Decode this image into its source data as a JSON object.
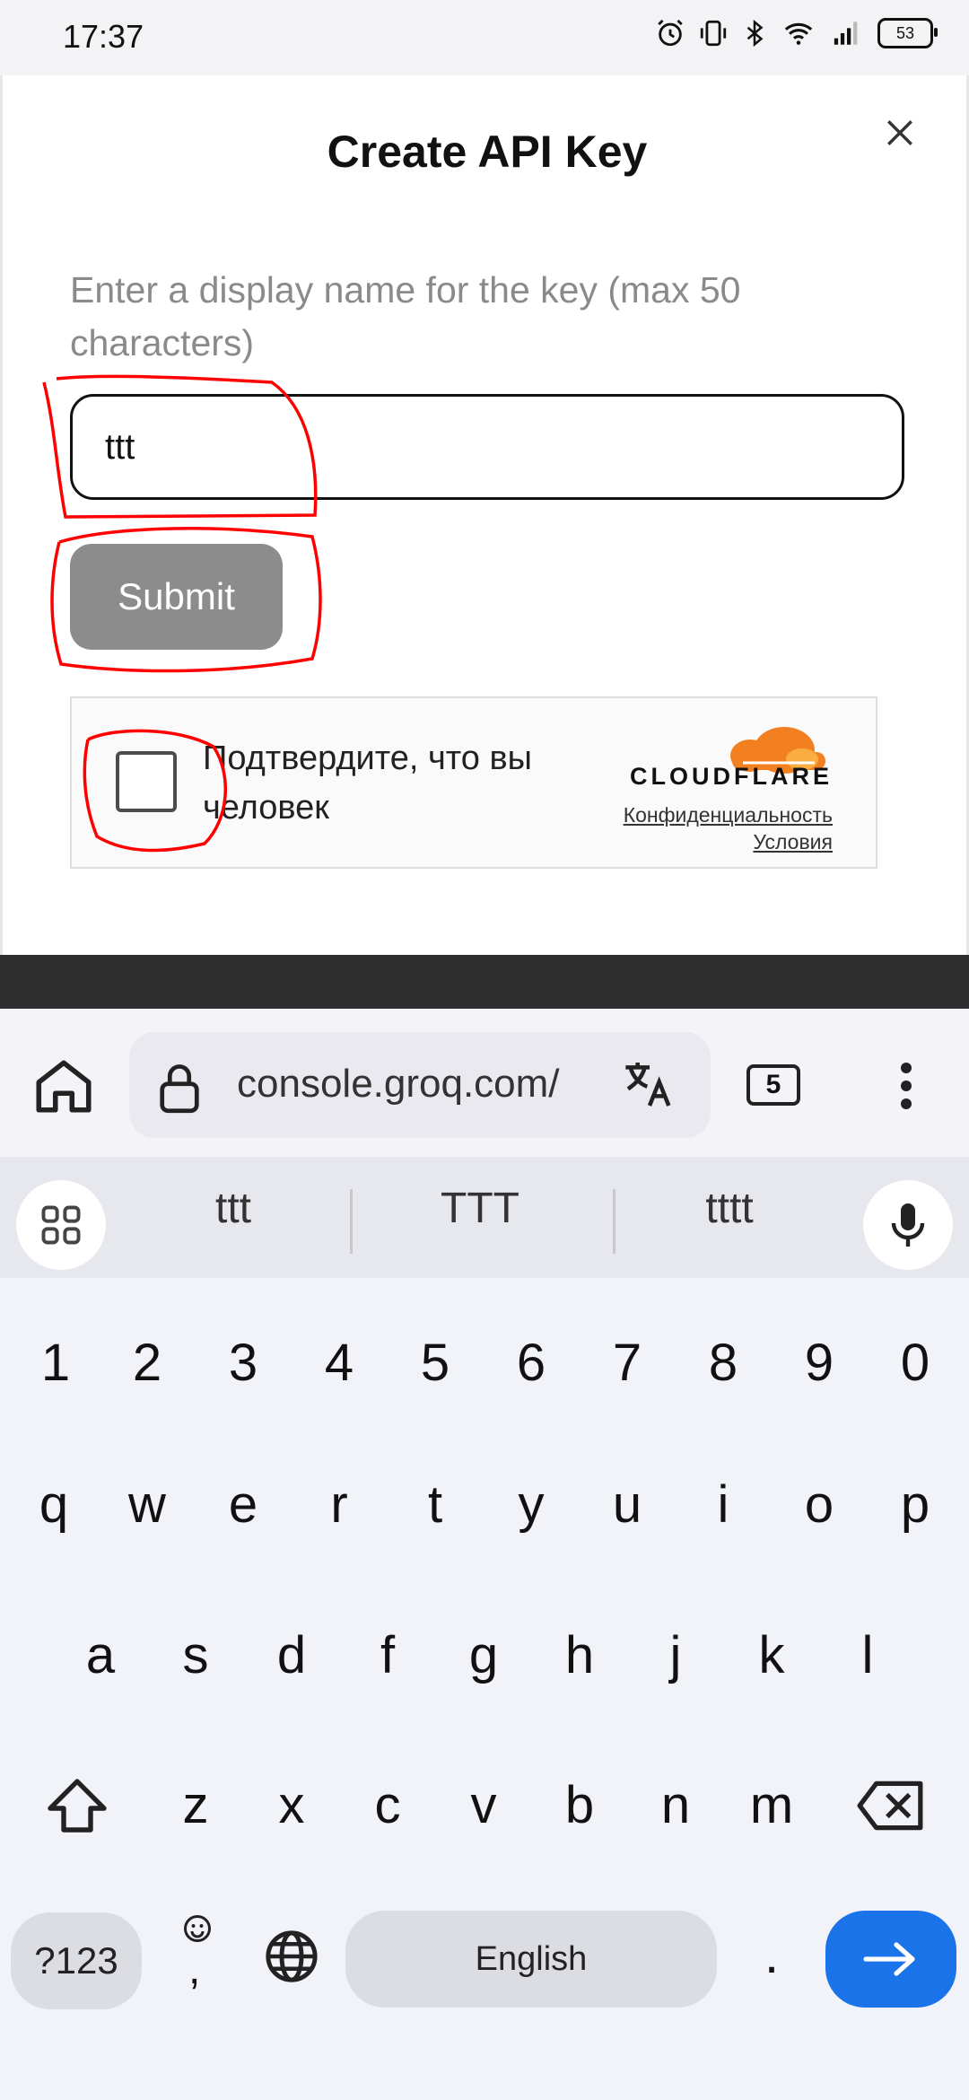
{
  "status_bar": {
    "time": "17:37",
    "battery": "53",
    "icons": [
      "alarm-icon",
      "vibrate-icon",
      "bluetooth-icon",
      "wifi-icon",
      "signal-icon",
      "battery-icon"
    ]
  },
  "dialog": {
    "title": "Create API Key",
    "prompt": "Enter a display name for the key (max 50 characters)",
    "name_value": "ttt",
    "submit_label": "Submit"
  },
  "captcha": {
    "label": "Подтвердите, что вы человек",
    "brand": "CLOUDFLARE",
    "privacy": "Конфиденциальность",
    "terms": "Условия",
    "brand_color": "#f38020"
  },
  "browser": {
    "url": "console.groq.com/",
    "tab_count": "5"
  },
  "keyboard": {
    "suggestions": [
      "ttt",
      "TTT",
      "tttt"
    ],
    "row_numbers": [
      "1",
      "2",
      "3",
      "4",
      "5",
      "6",
      "7",
      "8",
      "9",
      "0"
    ],
    "row_1": [
      "q",
      "w",
      "e",
      "r",
      "t",
      "y",
      "u",
      "i",
      "o",
      "p"
    ],
    "row_2": [
      "a",
      "s",
      "d",
      "f",
      "g",
      "h",
      "j",
      "k",
      "l"
    ],
    "row_3": [
      "z",
      "x",
      "c",
      "v",
      "b",
      "n",
      "m"
    ],
    "symbols_label": "?123",
    "comma_label": ",",
    "space_label": "English",
    "period_label": ".",
    "accent_color": "#1a73e8"
  },
  "annotation_color": "#ff0000"
}
